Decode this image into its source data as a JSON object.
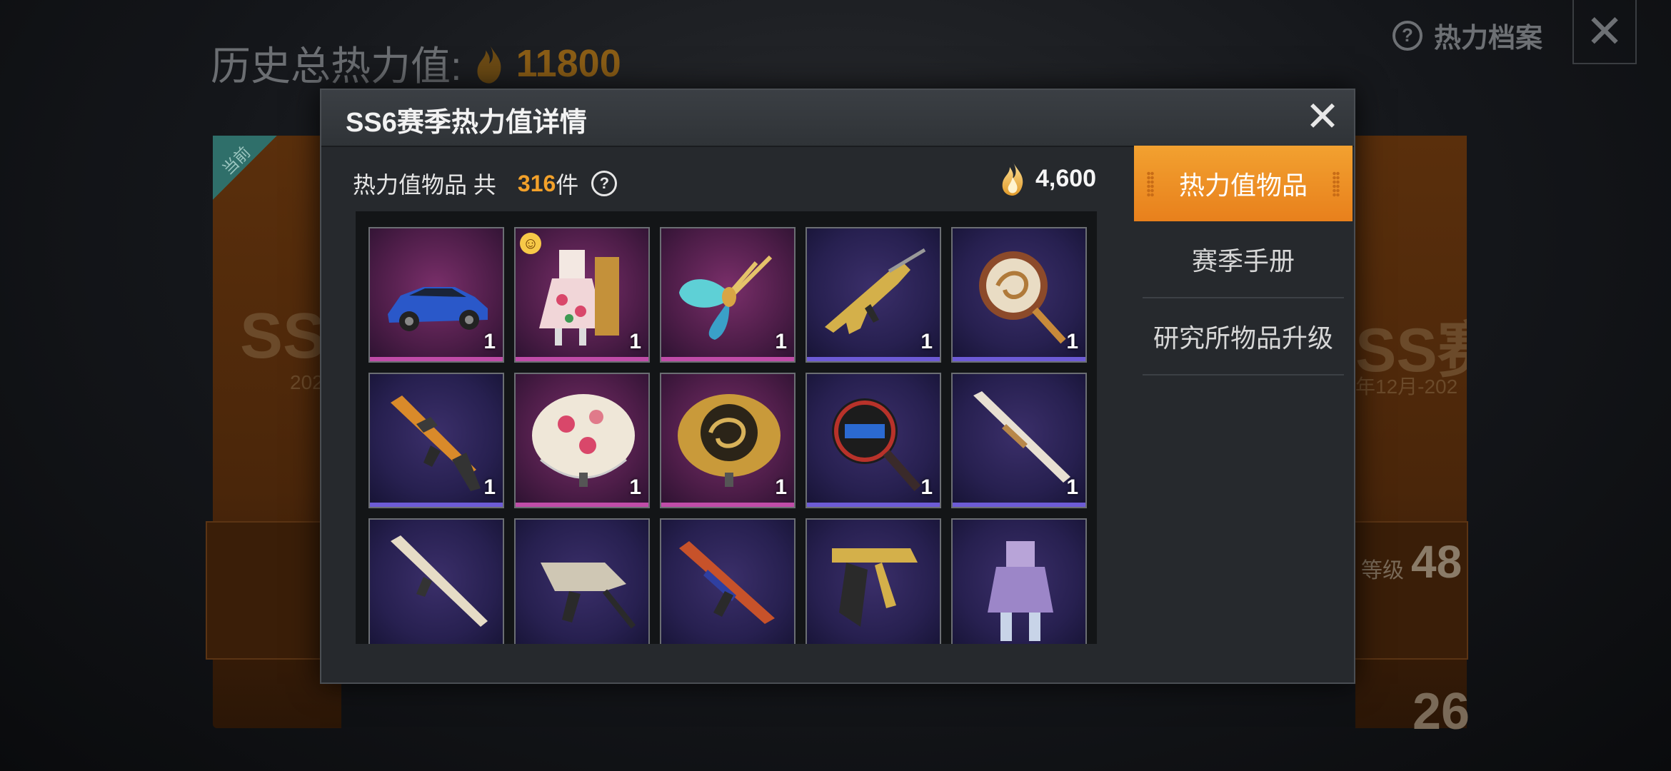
{
  "background": {
    "history_label": "历史总热力值:",
    "history_value": "11800",
    "archive_label": "热力档案",
    "close_label": "✕",
    "left_card": {
      "badge": "当前",
      "season_text": "SS",
      "year_text": "202"
    },
    "right_card": {
      "season_text": "SS赛",
      "date_text": "年12月-202",
      "level_label": "等级",
      "level_value": "48",
      "count_value": "26"
    }
  },
  "modal": {
    "title": "SS6赛季热力值详情",
    "close_label": "✕",
    "count_label": "热力值物品 共",
    "count_value": "316",
    "count_unit": "件",
    "total_value": "4,600",
    "help_symbol": "?"
  },
  "tabs": [
    {
      "label": "热力值物品",
      "active": true
    },
    {
      "label": "赛季手册",
      "active": false
    },
    {
      "label": "研究所物品升级",
      "active": false
    }
  ],
  "items": [
    {
      "name": "blue-sports-car",
      "qty": "1",
      "rarity": "pink"
    },
    {
      "name": "floral-outfit",
      "qty": "1",
      "rarity": "pink"
    },
    {
      "name": "butterfly-glider",
      "qty": "1",
      "rarity": "pink"
    },
    {
      "name": "gold-rifle-skin",
      "qty": "1",
      "rarity": "purple"
    },
    {
      "name": "dragon-pan",
      "qty": "1",
      "rarity": "purple"
    },
    {
      "name": "m416-skin",
      "qty": "1",
      "rarity": "purple"
    },
    {
      "name": "floral-parachute",
      "qty": "1",
      "rarity": "pink"
    },
    {
      "name": "dragon-parachute",
      "qty": "1",
      "rarity": "pink"
    },
    {
      "name": "black-pan",
      "qty": "1",
      "rarity": "purple"
    },
    {
      "name": "shotgun-skin",
      "qty": "1",
      "rarity": "purple"
    },
    {
      "name": "white-rifle-skin",
      "qty": "",
      "rarity": "purple"
    },
    {
      "name": "smg-skin",
      "qty": "",
      "rarity": "purple"
    },
    {
      "name": "akm-skin",
      "qty": "",
      "rarity": "purple"
    },
    {
      "name": "groza-skin",
      "qty": "",
      "rarity": "purple"
    },
    {
      "name": "lavender-outfit",
      "qty": "",
      "rarity": "purple"
    }
  ]
}
